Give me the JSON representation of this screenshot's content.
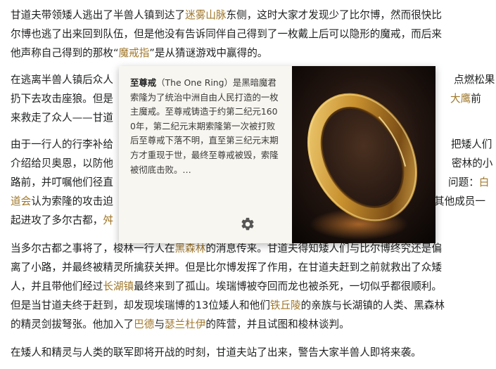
{
  "article": {
    "p1": {
      "l1_a": "甘道夫带领矮人逃出了半兽人镇到达了",
      "l1_link": "迷雾山脉",
      "l1_b": "东侧，这时大家才发现少了比尔博，然而很快比",
      "l2": "尔博也逃了出来回到队伍，但是他没有告诉同伴自己得到了一枚戴上后可以隐形的魔戒，而后来",
      "l3_a": "他声称自己得到的那枚“",
      "l3_link": "魔戒指",
      "l3_b": "”是从猜谜游戏中赢得的。"
    },
    "p2": {
      "l1_a": "在逃离半兽人镇后众人",
      "l1_b": "点燃松果",
      "l2_a": "扔下去攻击座狼。但是",
      "l2_link": "大鹰",
      "l2_b": "前",
      "l3": "来救走了众人——甘道"
    },
    "p3": {
      "l1_a": "由于一行人的行李补给",
      "l1_b": "把矮人们",
      "l2_a": "介绍给贝奥恩，以防他",
      "l2_b": "密林的小",
      "l3_a": "路前，并叮嘱他们径直",
      "l3_b": "问题：",
      "l3_link": "白",
      "l4_link": "道会",
      "l4_a": "认为索隆的攻击迫",
      "l4_b": "其他成员一",
      "l5_a": "起进攻了多尔古都，",
      "l5_link": "舛"
    },
    "p4": {
      "l1_a": "当多尔古都之事将了，梭林一行人在",
      "l1_link": "黑森林",
      "l1_b": "的消息传来。甘道夫得知矮人们与比尔博终究还是偏",
      "l2": "离了小路，并最终被精灵所擒获关押。但是比尔博发挥了作用，在甘道夫赶到之前就救出了众矮",
      "l3_a": "人，并且带他们经过",
      "l3_link": "长湖镇",
      "l3_b": "最终来到了孤山。埃瑞博被夺回而龙也被杀死，一切似乎都很顺利。",
      "l4_a": "但是当甘道夫终于赶到，却发现埃瑞博的13位矮人和他们",
      "l4_link": "铁丘陵",
      "l4_b": "的亲族与长湖镇的人类、黑森林",
      "l5_a": "的精灵剑拔弩张。他加入了",
      "l5_link1": "巴德",
      "l5_mid": "与",
      "l5_link2": "瑟兰杜伊",
      "l5_b": "的阵营，并且试图和梭林谈判。"
    },
    "p5": {
      "l1": "在矮人和精灵与人类的联军即将开战的时刻，甘道夫站了出来，警告大家半兽人即将来袭。"
    }
  },
  "popup": {
    "title": "至尊戒",
    "body": "（The One Ring）是黑暗魔君索隆为了统治中洲自由人民打造的一枚主魔戒。至尊戒铸造于约第二纪元1600年，第二纪元末期索隆第一次被打败后至尊戒下落不明，直至第三纪元末期方才重现于世，最终至尊戒被毁，索隆被彻底击败。…",
    "settings_icon": "gear-icon",
    "image_subject": "ring-image"
  },
  "colors": {
    "link": "#a0772a",
    "text": "#202122",
    "popup_bg": "#f8f6f0",
    "ring_gold": "#d4a238"
  }
}
